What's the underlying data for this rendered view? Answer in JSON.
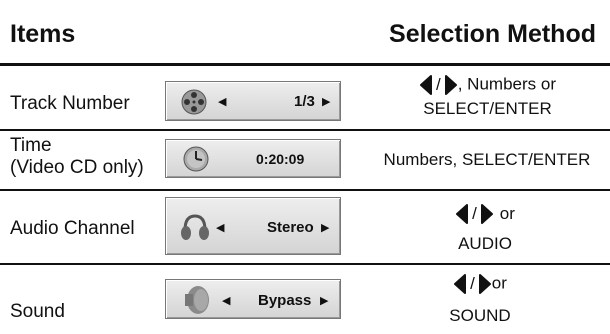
{
  "header": {
    "items": "Items",
    "method": "Selection Method"
  },
  "rows": [
    {
      "item": "Track Number",
      "osd_icon": "film-reel-icon",
      "osd_value": "1/3",
      "method_suffix": ", Numbers or",
      "method_line2": "SELECT/ENTER"
    },
    {
      "item_line1": "Time",
      "item_line2": "(Video CD only)",
      "osd_icon": "clock-icon",
      "osd_value": "0:20:09",
      "method": "Numbers, SELECT/ENTER"
    },
    {
      "item": "Audio Channel",
      "osd_icon": "headphones-icon",
      "osd_value": "Stereo",
      "method_suffix": "or",
      "method_line2": "AUDIO"
    },
    {
      "item": "Sound",
      "osd_icon": "speaker-icon",
      "osd_value": "Bypass",
      "method_suffix": "or",
      "method_line2": "SOUND"
    }
  ],
  "icons": {
    "left": "left-arrow-icon",
    "right": "right-arrow-icon",
    "slash": "/"
  }
}
